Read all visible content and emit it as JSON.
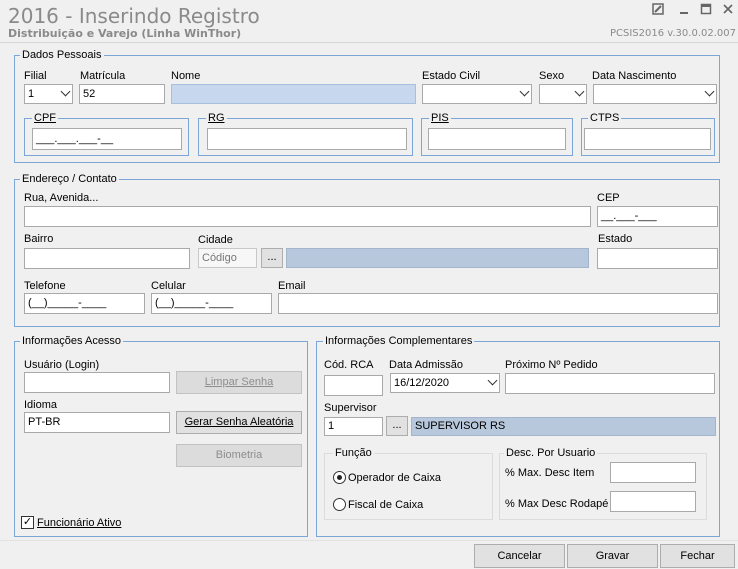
{
  "window": {
    "title": "2016 - Inserindo Registro",
    "subtitle": "Distribuição e Varejo (Linha WinThor)",
    "version": "PCSIS2016  v.30.0.02.007"
  },
  "dados_pessoais": {
    "legend": "Dados Pessoais",
    "filial_label": "Filial",
    "filial_value": "1",
    "matricula_label": "Matrícula",
    "matricula_value": "52",
    "nome_label": "Nome",
    "estado_civil_label": "Estado Civil",
    "sexo_label": "Sexo",
    "data_nascimento_label": "Data Nascimento",
    "cpf_legend": "CPF",
    "cpf_mask": "___.___.___-__",
    "rg_legend": "RG",
    "pis_legend": "PIS",
    "ctps_legend": "CTPS"
  },
  "endereco": {
    "legend": "Endereço / Contato",
    "rua_label": "Rua, Avenida...",
    "cep_label": "CEP",
    "cep_mask": "__.___-___",
    "bairro_label": "Bairro",
    "cidade_label": "Cidade",
    "cidade_placeholder": "Código",
    "cidade_btn": "...",
    "estado_label": "Estado",
    "telefone_label": "Telefone",
    "telefone_mask": "(__)_____-____",
    "celular_label": "Celular",
    "celular_mask": "(__)_____-____",
    "email_label": "Email"
  },
  "acesso": {
    "legend": "Informações Acesso",
    "usuario_label": "Usuário (Login)",
    "limpar_senha": "Limpar Senha",
    "idioma_label": "Idioma",
    "idioma_value": "PT-BR",
    "gerar_senha": "Gerar Senha Aleatória",
    "biometria": "Biometria",
    "funcionario_ativo": "Funcionário Ativo",
    "funcionario_ativo_checked": "✓"
  },
  "complementares": {
    "legend": "Informações Complementares",
    "cod_rca_label": "Cód. RCA",
    "data_admissao_label": "Data Admissão",
    "data_admissao_value": "16/12/2020",
    "proximo_pedido_label": "Próximo Nº Pedido",
    "supervisor_label": "Supervisor",
    "supervisor_code": "1",
    "supervisor_btn": "...",
    "supervisor_name": "SUPERVISOR RS",
    "funcao_legend": "Função",
    "operador_caixa": "Operador de Caixa",
    "fiscal_caixa": "Fiscal de Caixa",
    "desc_legend": "Desc. Por Usuario",
    "max_desc_item_label": "% Max. Desc Item",
    "max_desc_rodape_label": "% Max Desc Rodapé"
  },
  "footer": {
    "cancelar": "Cancelar",
    "gravar": "Gravar",
    "fechar": "Fechar"
  }
}
